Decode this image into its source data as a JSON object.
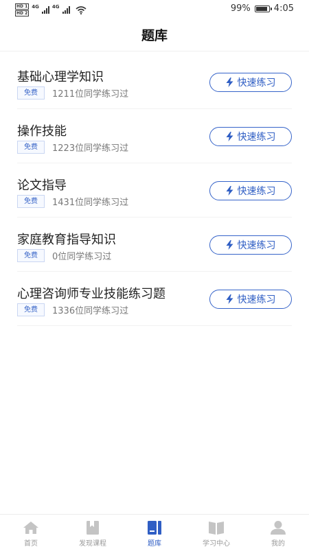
{
  "status_bar": {
    "sim1": "HD 1",
    "sim2": "HD 2",
    "network1": "4G",
    "network2": "4G",
    "battery_percent": "99%",
    "battery_level": 0.99,
    "time": "4:05"
  },
  "header": {
    "title": "题库"
  },
  "quiz_list": [
    {
      "title": "基础心理学知识",
      "badge": "免费",
      "count": "1211位同学练习过",
      "button": "快速练习"
    },
    {
      "title": "操作技能",
      "badge": "免费",
      "count": "1223位同学练习过",
      "button": "快速练习"
    },
    {
      "title": "论文指导",
      "badge": "免费",
      "count": "1431位同学练习过",
      "button": "快速练习"
    },
    {
      "title": "家庭教育指导知识",
      "badge": "免费",
      "count": "0位同学练习过",
      "button": "快速练习"
    },
    {
      "title": "心理咨询师专业技能练习题",
      "badge": "免费",
      "count": "1336位同学练习过",
      "button": "快速练习"
    }
  ],
  "tab_bar": {
    "active": "题库",
    "tabs": [
      {
        "label": "首页",
        "icon": "home-icon"
      },
      {
        "label": "发现课程",
        "icon": "bookmark-icon"
      },
      {
        "label": "题库",
        "icon": "question-bank-icon"
      },
      {
        "label": "学习中心",
        "icon": "open-book-icon"
      },
      {
        "label": "我的",
        "icon": "user-icon"
      }
    ]
  },
  "colors": {
    "accent": "#2f5ec4",
    "inactive": "#c4c4c4",
    "badge_border": "#c9d6f2"
  }
}
